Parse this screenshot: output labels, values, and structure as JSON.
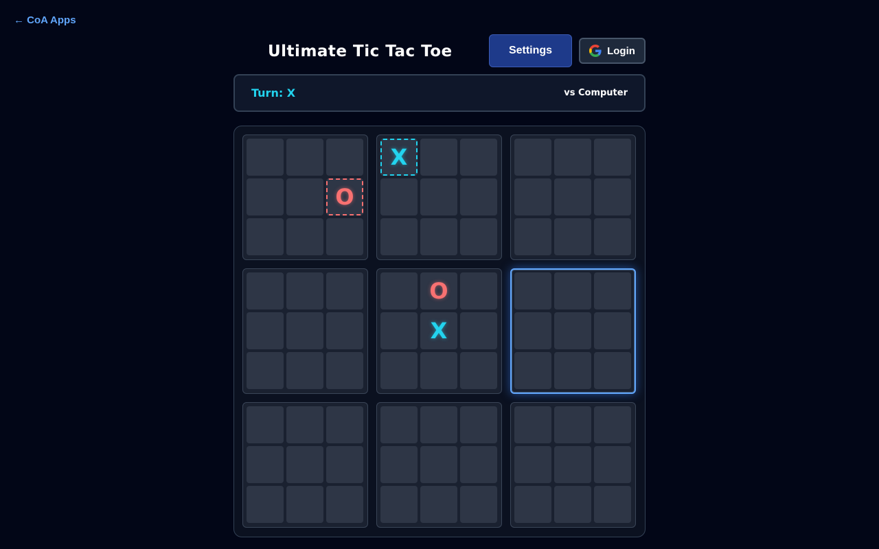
{
  "nav": {
    "back_label": "← CoA Apps"
  },
  "header": {
    "title": "Ultimate Tic Tac Toe",
    "settings_label": "Settings",
    "login_label": "Login"
  },
  "status": {
    "turn": "Turn: X",
    "opponent": "vs Computer"
  },
  "colors": {
    "background": "#020617",
    "x": "#22d3ee",
    "o": "#f87171",
    "active_board": "#60a5fa",
    "settings_button": "#1e3a8a"
  },
  "game": {
    "active_board": 5,
    "last_moves": [
      {
        "board": 0,
        "cell": 5
      },
      {
        "board": 1,
        "cell": 0
      }
    ],
    "boards": [
      [
        "",
        "",
        "",
        "",
        "",
        "O",
        "",
        "",
        ""
      ],
      [
        "X",
        "",
        "",
        "",
        "",
        "",
        "",
        "",
        ""
      ],
      [
        "",
        "",
        "",
        "",
        "",
        "",
        "",
        "",
        ""
      ],
      [
        "",
        "",
        "",
        "",
        "",
        "",
        "",
        "",
        ""
      ],
      [
        "",
        "O",
        "",
        "",
        "X",
        "",
        "",
        "",
        ""
      ],
      [
        "",
        "",
        "",
        "",
        "",
        "",
        "",
        "",
        ""
      ],
      [
        "",
        "",
        "",
        "",
        "",
        "",
        "",
        "",
        ""
      ],
      [
        "",
        "",
        "",
        "",
        "",
        "",
        "",
        "",
        ""
      ],
      [
        "",
        "",
        "",
        "",
        "",
        "",
        "",
        "",
        ""
      ]
    ]
  }
}
